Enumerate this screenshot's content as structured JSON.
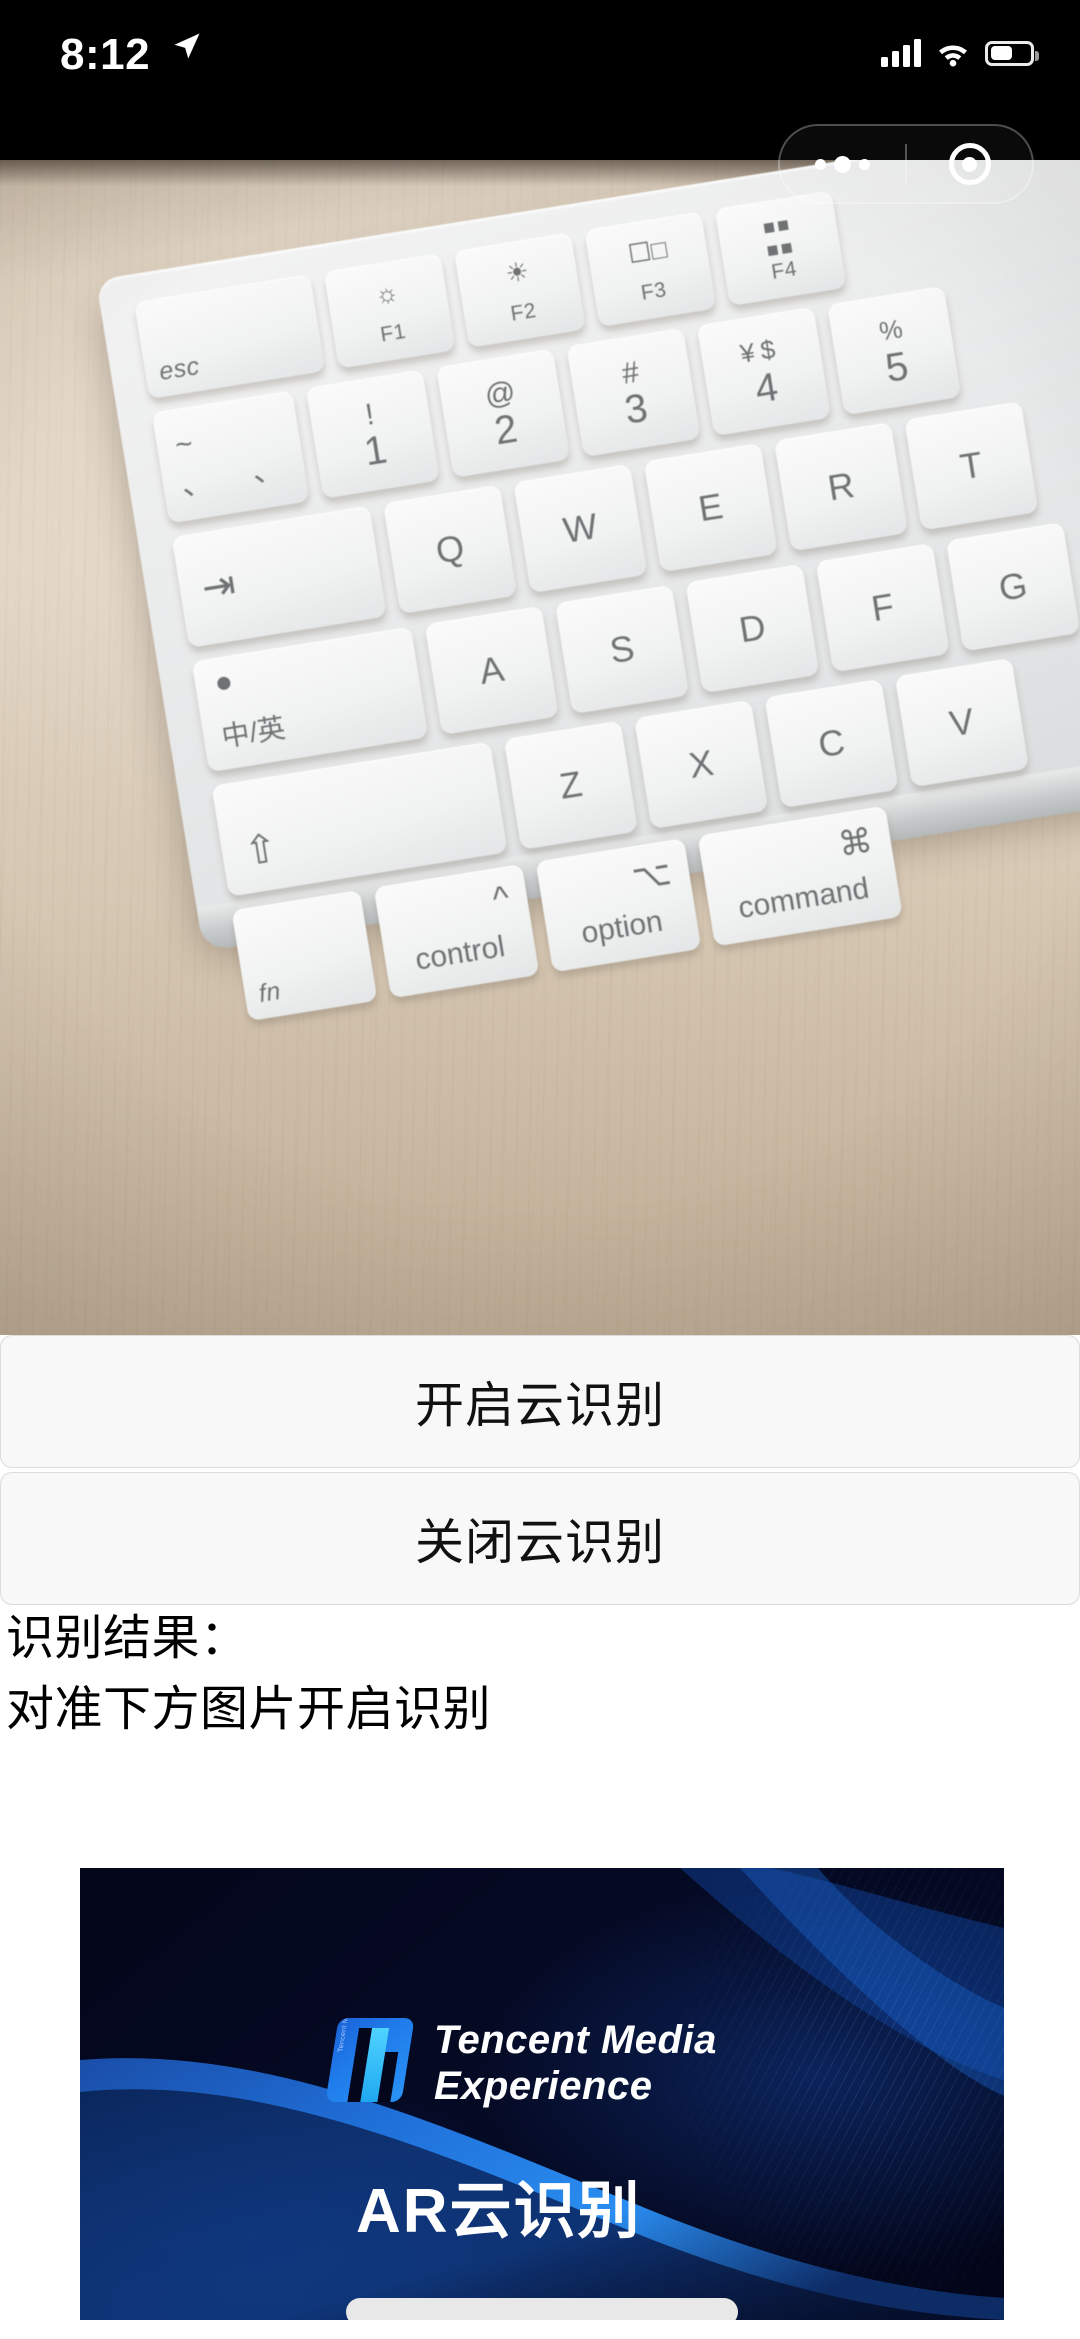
{
  "status_bar": {
    "time": "8:12",
    "location_icon": "location-arrow-icon",
    "signal_icon": "cellular-signal-icon",
    "signal_bars": 4,
    "wifi_icon": "wifi-icon",
    "battery_icon": "battery-icon",
    "battery_level_percent": 50
  },
  "capsule": {
    "menu_icon": "more-options-icon",
    "close_icon": "close-target-icon"
  },
  "camera": {
    "label": "camera-live-preview",
    "scene": "Apple Magic Keyboard on light wood desk",
    "keyboard": {
      "function_row": [
        {
          "label": "esc",
          "glyph": ""
        },
        {
          "label": "F1",
          "glyph": "☀"
        },
        {
          "label": "F2",
          "glyph": "☀"
        },
        {
          "label": "F3",
          "glyph": "❐"
        },
        {
          "label": "F4",
          "glyph": "∷"
        }
      ],
      "number_row": [
        {
          "top": "~",
          "bottom": "、"
        },
        {
          "top": "!",
          "bottom": "1"
        },
        {
          "top": "@",
          "bottom": "2"
        },
        {
          "top": "#",
          "bottom": "3"
        },
        {
          "top": "¥ $",
          "bottom": "4"
        }
      ],
      "q_row": [
        "→|",
        "Q",
        "W",
        "E",
        "R"
      ],
      "a_row": [
        "中/英",
        "A",
        "S",
        "D",
        "F"
      ],
      "z_row": [
        "⇧",
        "Z",
        "X",
        "C"
      ],
      "bottom_row": [
        {
          "sym": "",
          "label": "fn"
        },
        {
          "sym": "⌃",
          "label": "control"
        },
        {
          "sym": "⌥",
          "label": "option"
        },
        {
          "sym": "⌘",
          "label": "command"
        }
      ]
    }
  },
  "actions": {
    "start_button": "开启云识别",
    "stop_button": "关闭云识别"
  },
  "result": {
    "label": "识别结果：",
    "value": "对准下方图片开启识别"
  },
  "banner": {
    "brand_line1": "Tencent Media",
    "brand_line2": "Experience",
    "logo_micro_text": "Tencent Media",
    "title": "AR云识别",
    "logo_icon": "tme-logo-icon"
  },
  "colors": {
    "status_bar_bg": "#000000",
    "page_bg": "#ffffff",
    "button_bg": "#f8f8f8",
    "button_border": "#dcdcdc",
    "text": "#111111",
    "banner_bg": "#04071c",
    "banner_accent": "#1f7bea",
    "banner_accent_light": "#4fd3ff"
  }
}
